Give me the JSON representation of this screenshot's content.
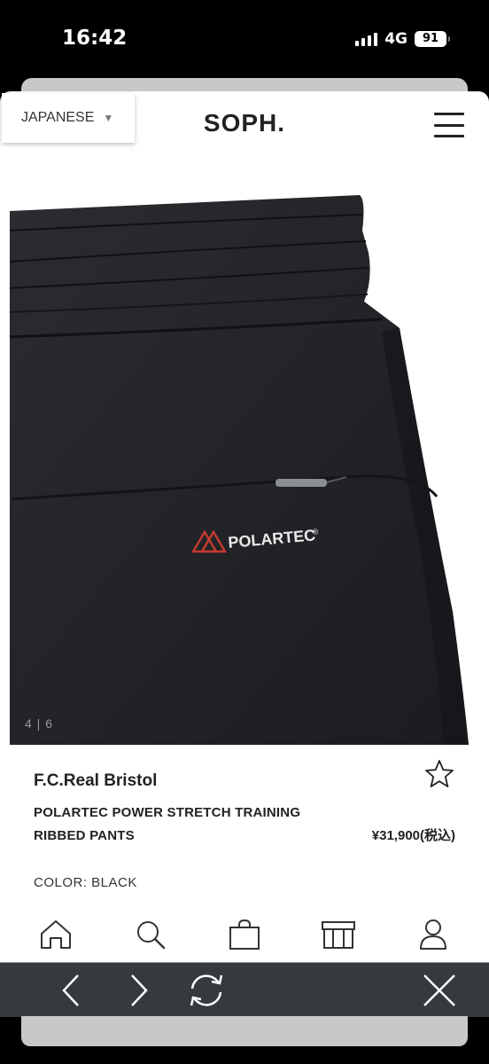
{
  "status_bar": {
    "time": "16:42",
    "network": "4G",
    "battery": "91"
  },
  "header": {
    "language": "JAPANESE",
    "logo": "SOPH."
  },
  "gallery": {
    "counter": "4 | 6",
    "current": 4,
    "total": 6,
    "logo_text": "POLARTEC",
    "logo_mark": "®"
  },
  "product": {
    "brand": "F.C.Real Bristol",
    "name_line1": "POLARTEC POWER STRETCH TRAINING",
    "name_line2": "RIBBED PANTS",
    "price": "¥31,900(税込)",
    "color": "COLOR: BLACK"
  },
  "bottom_nav": [
    "home-icon",
    "search-icon",
    "bag-icon",
    "store-icon",
    "account-icon"
  ],
  "browser_toolbar": [
    "back-icon",
    "forward-icon",
    "reload-icon",
    "close-icon"
  ],
  "colors": {
    "accent_red": "#c23b2e",
    "garment": "#1f2124",
    "toolbar": "#353a3f"
  }
}
